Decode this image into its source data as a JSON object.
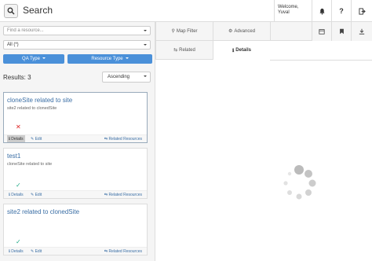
{
  "header": {
    "search_label": "Search",
    "welcome_line1": "Welcome,",
    "welcome_user": "Yuval",
    "icons": [
      "search-icon",
      "bell-icon",
      "help-icon",
      "logout-icon"
    ]
  },
  "filters": {
    "resource_placeholder": "Find a resource...",
    "resource_scope": "All (*)",
    "qa_type_label": "QA Type",
    "resource_type_label": "Resource Type"
  },
  "results": {
    "label": "Results: 3",
    "sort_value": "Ascending"
  },
  "cards": [
    {
      "title": "cloneSite related to site",
      "subtitle": "site2 related to clonedSite",
      "details": "Details",
      "edit": "Edit",
      "related": "Related Resources",
      "status": "✕"
    },
    {
      "title": "test1",
      "subtitle": "cloneSite related to site",
      "details": "Details",
      "edit": "Edit",
      "related": "Related Resources",
      "status": "✓"
    },
    {
      "title": "site2 related to clonedSite",
      "subtitle": "",
      "details": "Details",
      "edit": "Edit",
      "related": "Related Resources",
      "status": "✓"
    }
  ],
  "tabs": {
    "map_filter": "Map Filter",
    "advanced": "Advanced",
    "related": "Related",
    "details": "Details"
  },
  "colors": {
    "accent": "#4a90d9",
    "link": "#3a6ea5",
    "error": "#dd2222",
    "ok": "#22aa88"
  }
}
